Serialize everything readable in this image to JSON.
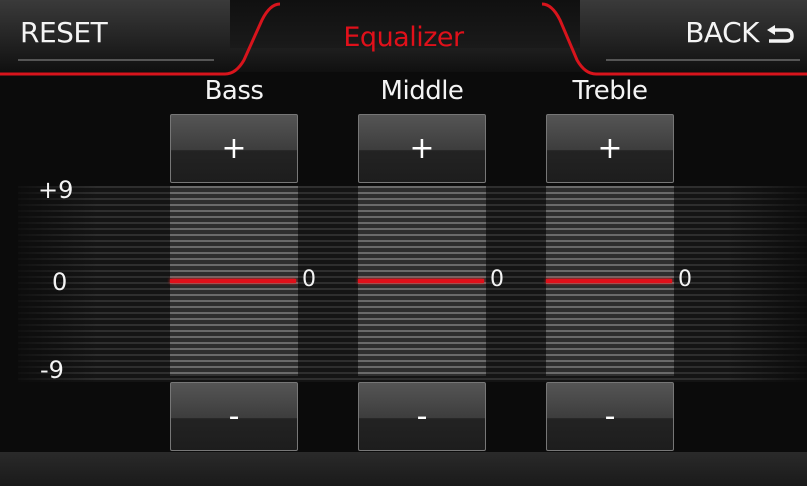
{
  "header": {
    "title": "Equalizer",
    "reset_label": "RESET",
    "back_label": "BACK"
  },
  "icons": {
    "back": "return-arrow-icon"
  },
  "colors": {
    "accent": "#e0101a",
    "background": "#0b0b0b",
    "text": "#f2f2f2"
  },
  "axis": {
    "max_label": "+9",
    "mid_label": "0",
    "min_label": "-9",
    "min": -9,
    "max": 9
  },
  "bands": [
    {
      "label": "Bass",
      "plus_label": "+",
      "minus_label": "-",
      "value": 0,
      "value_label": "0"
    },
    {
      "label": "Middle",
      "plus_label": "+",
      "minus_label": "-",
      "value": 0,
      "value_label": "0"
    },
    {
      "label": "Treble",
      "plus_label": "+",
      "minus_label": "-",
      "value": 0,
      "value_label": "0"
    }
  ]
}
